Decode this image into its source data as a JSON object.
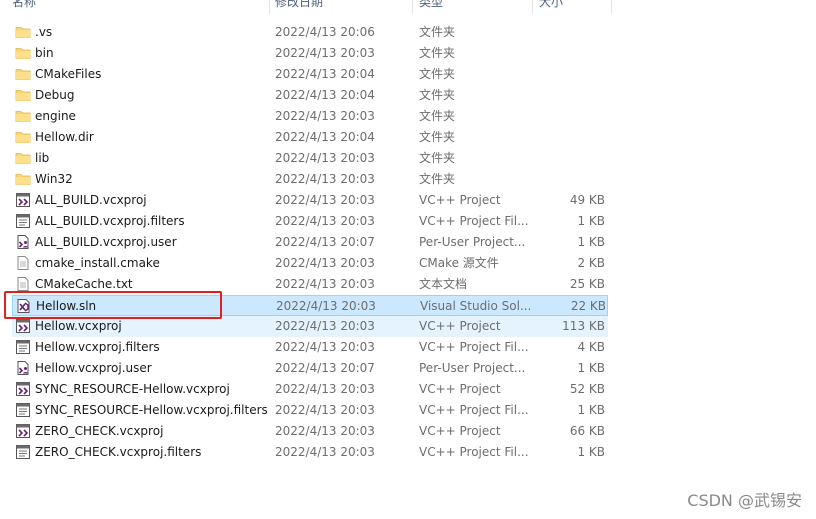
{
  "header": {
    "name": "名称",
    "date": "修改日期",
    "type": "类型",
    "size": "大小"
  },
  "files": [
    {
      "name": ".vs",
      "date": "2022/4/13 20:06",
      "type": "文件夹",
      "size": "",
      "icon": "folder-icon"
    },
    {
      "name": "bin",
      "date": "2022/4/13 20:03",
      "type": "文件夹",
      "size": "",
      "icon": "folder-icon"
    },
    {
      "name": "CMakeFiles",
      "date": "2022/4/13 20:04",
      "type": "文件夹",
      "size": "",
      "icon": "folder-icon"
    },
    {
      "name": "Debug",
      "date": "2022/4/13 20:04",
      "type": "文件夹",
      "size": "",
      "icon": "folder-icon"
    },
    {
      "name": "engine",
      "date": "2022/4/13 20:03",
      "type": "文件夹",
      "size": "",
      "icon": "folder-icon"
    },
    {
      "name": "Hellow.dir",
      "date": "2022/4/13 20:04",
      "type": "文件夹",
      "size": "",
      "icon": "folder-icon"
    },
    {
      "name": "lib",
      "date": "2022/4/13 20:03",
      "type": "文件夹",
      "size": "",
      "icon": "folder-icon"
    },
    {
      "name": "Win32",
      "date": "2022/4/13 20:03",
      "type": "文件夹",
      "size": "",
      "icon": "folder-icon"
    },
    {
      "name": "ALL_BUILD.vcxproj",
      "date": "2022/4/13 20:03",
      "type": "VC++ Project",
      "size": "49 KB",
      "icon": "vcxproj-icon"
    },
    {
      "name": "ALL_BUILD.vcxproj.filters",
      "date": "2022/4/13 20:03",
      "type": "VC++ Project Fil...",
      "size": "1 KB",
      "icon": "filters-icon"
    },
    {
      "name": "ALL_BUILD.vcxproj.user",
      "date": "2022/4/13 20:07",
      "type": "Per-User Project...",
      "size": "1 KB",
      "icon": "user-file-icon"
    },
    {
      "name": "cmake_install.cmake",
      "date": "2022/4/13 20:03",
      "type": "CMake 源文件",
      "size": "2 KB",
      "icon": "text-file-icon"
    },
    {
      "name": "CMakeCache.txt",
      "date": "2022/4/13 20:03",
      "type": "文本文档",
      "size": "25 KB",
      "icon": "text-file-icon"
    },
    {
      "name": "Hellow.sln",
      "date": "2022/4/13 20:03",
      "type": "Visual Studio Sol...",
      "size": "22 KB",
      "icon": "sln-icon",
      "state": "selected"
    },
    {
      "name": "Hellow.vcxproj",
      "date": "2022/4/13 20:03",
      "type": "VC++ Project",
      "size": "113 KB",
      "icon": "vcxproj-icon",
      "state": "hover"
    },
    {
      "name": "Hellow.vcxproj.filters",
      "date": "2022/4/13 20:03",
      "type": "VC++ Project Fil...",
      "size": "4 KB",
      "icon": "filters-icon"
    },
    {
      "name": "Hellow.vcxproj.user",
      "date": "2022/4/13 20:07",
      "type": "Per-User Project...",
      "size": "1 KB",
      "icon": "user-file-icon"
    },
    {
      "name": "SYNC_RESOURCE-Hellow.vcxproj",
      "date": "2022/4/13 20:03",
      "type": "VC++ Project",
      "size": "52 KB",
      "icon": "vcxproj-icon"
    },
    {
      "name": "SYNC_RESOURCE-Hellow.vcxproj.filters",
      "date": "2022/4/13 20:03",
      "type": "VC++ Project Fil...",
      "size": "1 KB",
      "icon": "filters-icon"
    },
    {
      "name": "ZERO_CHECK.vcxproj",
      "date": "2022/4/13 20:03",
      "type": "VC++ Project",
      "size": "66 KB",
      "icon": "vcxproj-icon"
    },
    {
      "name": "ZERO_CHECK.vcxproj.filters",
      "date": "2022/4/13 20:03",
      "type": "VC++ Project Fil...",
      "size": "1 KB",
      "icon": "filters-icon"
    }
  ],
  "watermark": "CSDN @武锡安",
  "colors": {
    "selected_bg": "#cce8ff",
    "hover_bg": "#e5f3ff",
    "annotation_border": "#e01f1f",
    "folder": "#f8d775"
  }
}
